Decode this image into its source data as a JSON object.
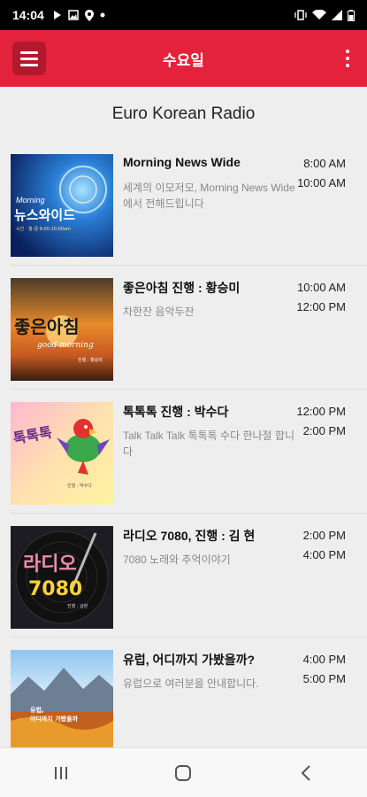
{
  "status": {
    "time": "14:04"
  },
  "app_bar": {
    "title": "수요일"
  },
  "station": "Euro Korean Radio",
  "programs": [
    {
      "title": "Morning News Wide",
      "desc": "세계의 이모저모, Morning News Wide에서 전해드립니다",
      "start": "8:00 AM",
      "end": "10:00 AM",
      "thumb": {
        "line1": "Morning",
        "line2": "뉴스와이드",
        "line3": "시간 · 월-금 9:00-10:00am"
      }
    },
    {
      "title": "좋은아침 진행 : 황승미",
      "desc": "차한잔 음악두잔",
      "start": "10:00 AM",
      "end": "12:00 PM",
      "thumb": {
        "line1": "좋은아침",
        "line2": "good morning",
        "line3": "진행 : 황승미"
      }
    },
    {
      "title": "톡톡톡  진행 : 박수다",
      "desc": "Talk Talk Talk 톡톡톡 수다 한나절 합니다",
      "start": "12:00 PM",
      "end": "2:00 PM",
      "thumb": {
        "line1": "톡톡톡",
        "line2": "진행 : 박수다"
      }
    },
    {
      "title": "라디오 7080,  진행 : 김 현",
      "desc": "7080 노래와 추억이야기",
      "start": "2:00 PM",
      "end": "4:00 PM",
      "thumb": {
        "line1": "라디오",
        "line2": "7080",
        "line3": "진행 : 김현"
      }
    },
    {
      "title": "유럽, 어디까지 가봤을까?",
      "desc": "유럽으로 여러분을 안내합니다.",
      "start": "4:00 PM",
      "end": "5:00 PM",
      "thumb": {
        "line1": "유럽,",
        "line2": "어디까지 가봤을까"
      }
    }
  ],
  "icons": {
    "menu": "hamburger-icon",
    "more": "more-vert-icon",
    "recents": "recents-icon",
    "home": "home-icon",
    "back": "back-icon"
  },
  "colors": {
    "accent": "#e4223b",
    "accent_dark": "#b3192c"
  }
}
